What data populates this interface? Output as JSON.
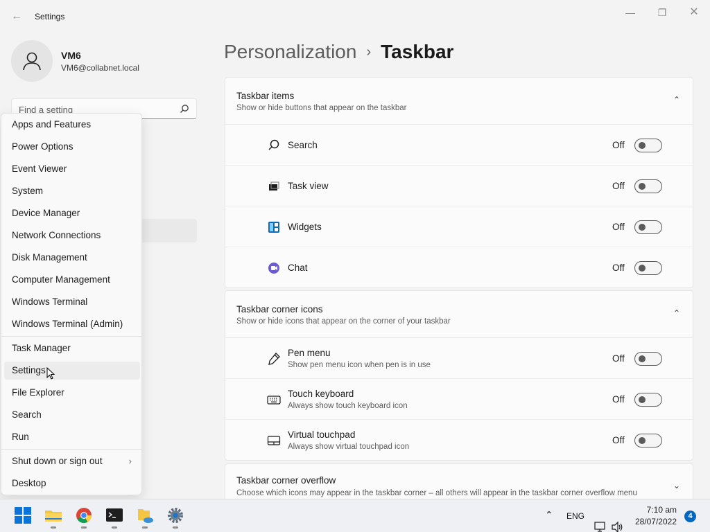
{
  "window": {
    "app_title": "Settings"
  },
  "user": {
    "name": "VM6",
    "email": "VM6@collabnet.local"
  },
  "search": {
    "placeholder": "Find a setting"
  },
  "context_menu": {
    "items": [
      {
        "label": "Apps and Features"
      },
      {
        "label": "Power Options"
      },
      {
        "label": "Event Viewer"
      },
      {
        "label": "System"
      },
      {
        "label": "Device Manager"
      },
      {
        "label": "Network Connections"
      },
      {
        "label": "Disk Management"
      },
      {
        "label": "Computer Management"
      },
      {
        "label": "Windows Terminal"
      },
      {
        "label": "Windows Terminal (Admin)"
      },
      {
        "label": "Task Manager"
      },
      {
        "label": "Settings"
      },
      {
        "label": "File Explorer"
      },
      {
        "label": "Search"
      },
      {
        "label": "Run"
      },
      {
        "label": "Shut down or sign out"
      },
      {
        "label": "Desktop"
      }
    ],
    "hovered": "Settings"
  },
  "breadcrumb": {
    "parent": "Personalization",
    "separator": "›",
    "current": "Taskbar"
  },
  "taskbar_items": {
    "title": "Taskbar items",
    "subtitle": "Show or hide buttons that appear on the taskbar",
    "rows": [
      {
        "label": "Search",
        "state": "Off",
        "icon": "search-icon"
      },
      {
        "label": "Task view",
        "state": "Off",
        "icon": "task-view-icon"
      },
      {
        "label": "Widgets",
        "state": "Off",
        "icon": "widgets-icon"
      },
      {
        "label": "Chat",
        "state": "Off",
        "icon": "chat-icon"
      }
    ]
  },
  "corner_icons": {
    "title": "Taskbar corner icons",
    "subtitle": "Show or hide icons that appear on the corner of your taskbar",
    "rows": [
      {
        "label": "Pen menu",
        "desc": "Show pen menu icon when pen is in use",
        "state": "Off",
        "icon": "pen-icon"
      },
      {
        "label": "Touch keyboard",
        "desc": "Always show touch keyboard icon",
        "state": "Off",
        "icon": "keyboard-icon"
      },
      {
        "label": "Virtual touchpad",
        "desc": "Always show virtual touchpad icon",
        "state": "Off",
        "icon": "touchpad-icon"
      }
    ]
  },
  "corner_overflow": {
    "title": "Taskbar corner overflow",
    "subtitle": "Choose which icons may appear in the taskbar corner – all others will appear in the taskbar corner overflow menu"
  },
  "system_tray": {
    "language": "ENG",
    "time": "7:10 am",
    "date": "28/07/2022",
    "notifications": "4"
  },
  "colors": {
    "accent": "#0067c0",
    "toggle_off": "#5a5a5a"
  }
}
